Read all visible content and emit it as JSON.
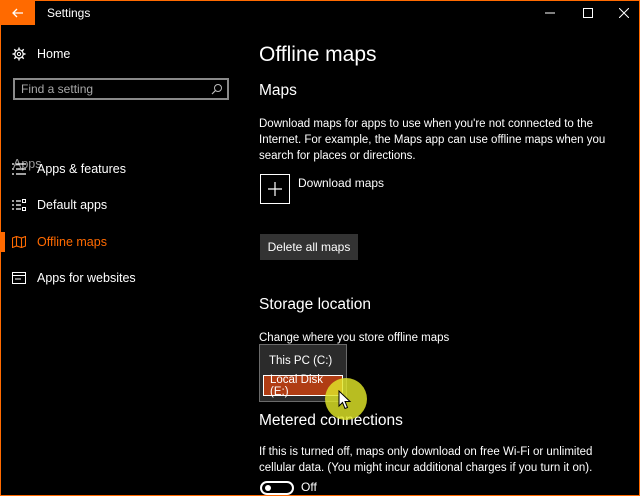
{
  "window": {
    "title": "Settings",
    "accent": "#ff6a00"
  },
  "sidebar": {
    "home": {
      "label": "Home",
      "icon": "gear-icon"
    },
    "search": {
      "placeholder": "Find a setting"
    },
    "section": "Apps",
    "items": [
      {
        "label": "Apps & features",
        "icon": "list-icon"
      },
      {
        "label": "Default apps",
        "icon": "default-apps-icon"
      },
      {
        "label": "Offline maps",
        "icon": "map-icon",
        "active": true
      },
      {
        "label": "Apps for websites",
        "icon": "websites-icon"
      }
    ]
  },
  "main": {
    "title": "Offline maps",
    "maps": {
      "heading": "Maps",
      "description": "Download maps for apps to use when you're not connected to the Internet. For example, the Maps app can use offline maps when you search for places or directions.",
      "download_label": "Download maps",
      "delete_label": "Delete all maps"
    },
    "storage": {
      "heading": "Storage location",
      "description": "Change where you store offline maps",
      "options": [
        "This PC (C:)",
        "Local Disk (E:)"
      ],
      "selected": "Local Disk (E:)"
    },
    "metered": {
      "heading": "Metered connections",
      "description": "If this is turned off, maps only download on free Wi-Fi or unlimited cellular data. (You might incur additional charges if you turn it on).",
      "toggle_label": "Off",
      "toggle_on": false
    }
  }
}
